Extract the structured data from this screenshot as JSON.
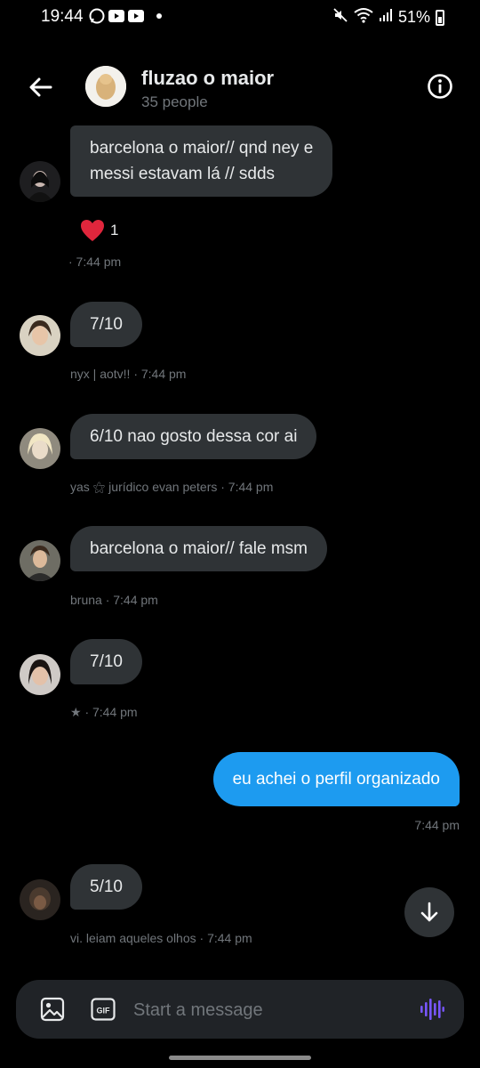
{
  "status_bar": {
    "time": "19:44",
    "battery": "51%"
  },
  "header": {
    "title": "fluzao o maior",
    "subtitle": "35 people"
  },
  "messages": [
    {
      "text": "barcelona o maior// qnd ney e\nmessi estavam lá // sdds",
      "meta": "· 7:44 pm",
      "reaction": {
        "emoji": "❤️",
        "count": "1"
      }
    },
    {
      "text": "7/10",
      "meta": "nyx | aotv!! · 7:44 pm"
    },
    {
      "text": "6/10 nao gosto dessa cor ai",
      "meta": "yas ⚝ jurídico evan peters · 7:44 pm"
    },
    {
      "text": "barcelona o maior// fale msm",
      "meta": "bruna · 7:44 pm"
    },
    {
      "text": "7/10",
      "meta": "★ · 7:44 pm"
    },
    {
      "text": "5/10",
      "meta": "vi. leiam aqueles olhos · 7:44 pm"
    }
  ],
  "outgoing": {
    "text": "eu achei o perfil organizado",
    "meta": "7:44 pm"
  },
  "composer": {
    "placeholder": "Start a message"
  },
  "colors": {
    "accent": "#1d9bf0",
    "bubble": "#2f3336",
    "muted": "#71767b",
    "voice": "#7856ff"
  },
  "icons": [
    "back-arrow-icon",
    "info-icon",
    "heart-icon",
    "arrow-down-icon",
    "image-icon",
    "gif-icon",
    "voice-wave-icon"
  ]
}
